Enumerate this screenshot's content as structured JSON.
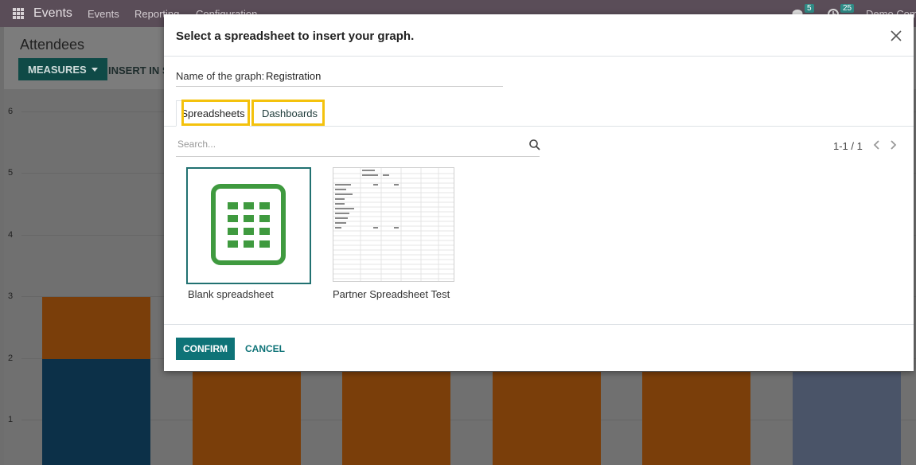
{
  "navbar": {
    "app_name": "Events",
    "menus": [
      "Events",
      "Reporting",
      "Configuration"
    ],
    "messages_count": "5",
    "activities_count": "25",
    "company": "Demo Com"
  },
  "control_panel": {
    "title": "Attendees",
    "measures_label": "MEASURES",
    "insert_label": "INSERT IN SP"
  },
  "graph": {
    "y_ticks": [
      "6",
      "5",
      "4",
      "3",
      "2",
      "1"
    ]
  },
  "modal": {
    "title": "Select a spreadsheet to insert your graph.",
    "name_label": "Name of the graph:",
    "name_value": "Registration",
    "tabs": [
      "Spreadsheets",
      "Dashboards"
    ],
    "search_placeholder": "Search...",
    "pager": "1-1 / 1",
    "cards": [
      {
        "label": "Blank spreadsheet"
      },
      {
        "label": "Partner Spreadsheet Test"
      }
    ],
    "confirm_label": "CONFIRM",
    "cancel_label": "CANCEL"
  },
  "colors": {
    "accent": "#0e7377",
    "highlight": "#f4c20d",
    "spreadsheet_green": "#3f9a3f"
  }
}
